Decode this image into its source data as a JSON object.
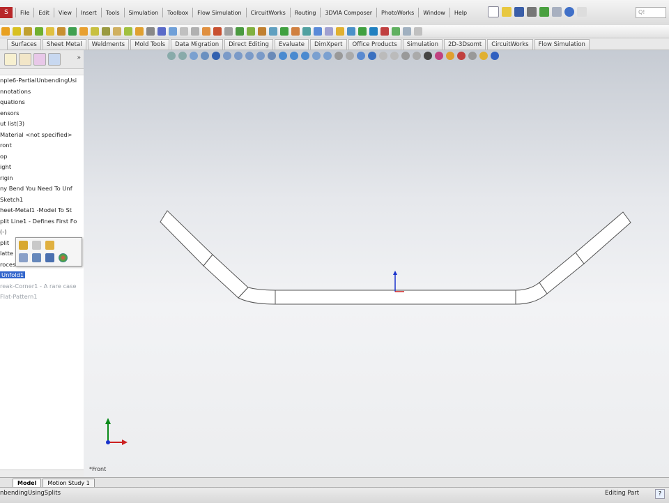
{
  "app": {
    "badge": "S"
  },
  "menu": {
    "items": [
      "File",
      "Edit",
      "View",
      "Insert",
      "Tools",
      "Simulation",
      "Toolbox",
      "Flow Simulation",
      "CircuitWorks",
      "Routing",
      "3DVIA Composer",
      "PhotoWorks",
      "Window",
      "Help"
    ],
    "search_placeholder": "Q!"
  },
  "command_tabs": [
    "Surfaces",
    "Sheet Metal",
    "Weldments",
    "Mold Tools",
    "Data Migration",
    "Direct Editing",
    "Evaluate",
    "DimXpert",
    "Office Products",
    "Simulation",
    "2D-3Dsomt",
    "CircuitWorks",
    "Flow Simulation"
  ],
  "feature_tree": {
    "items": [
      {
        "label": "nple6-PartialUnbendingUsi",
        "state": "normal"
      },
      {
        "label": "nnotations",
        "state": "normal"
      },
      {
        "label": "quations",
        "state": "normal"
      },
      {
        "label": "ensors",
        "state": "normal"
      },
      {
        "label": "ut list(3)",
        "state": "normal"
      },
      {
        "label": "Material <not specified>",
        "state": "normal"
      },
      {
        "label": "ront",
        "state": "normal"
      },
      {
        "label": "op",
        "state": "normal"
      },
      {
        "label": "ight",
        "state": "normal"
      },
      {
        "label": "rigin",
        "state": "normal"
      },
      {
        "label": "ny Bend You Need To Unf",
        "state": "normal"
      },
      {
        "label": "Sketch1",
        "state": "normal"
      },
      {
        "label": "heet-Metal1 -Model To St",
        "state": "normal"
      },
      {
        "label": "plit Line1 - Defines First Fo",
        "state": "normal"
      },
      {
        "label": "(-)",
        "state": "normal"
      },
      {
        "label": "plit",
        "state": "normal"
      },
      {
        "label": "latte",
        "state": "normal"
      },
      {
        "label": "rocess-Bends1",
        "state": "normal"
      },
      {
        "label": "Unfold1",
        "state": "selected"
      },
      {
        "label": "reak-Corner1 - A rare case",
        "state": "suppressed"
      },
      {
        "label": "Flat-Pattern1",
        "state": "suppressed"
      }
    ]
  },
  "viewport": {
    "view_label": "*Front"
  },
  "bottom_tabs": [
    {
      "label": "Model",
      "active": true
    },
    {
      "label": "Motion Study 1",
      "active": false
    }
  ],
  "status": {
    "left": "nbendingUsingSplits",
    "right": "Editing Part",
    "help": "?"
  },
  "colors": {
    "selection": "#3366cc",
    "y_axis": "#0a8a1a",
    "x_axis": "#cc2020",
    "z_axis": "#1a33cc"
  }
}
